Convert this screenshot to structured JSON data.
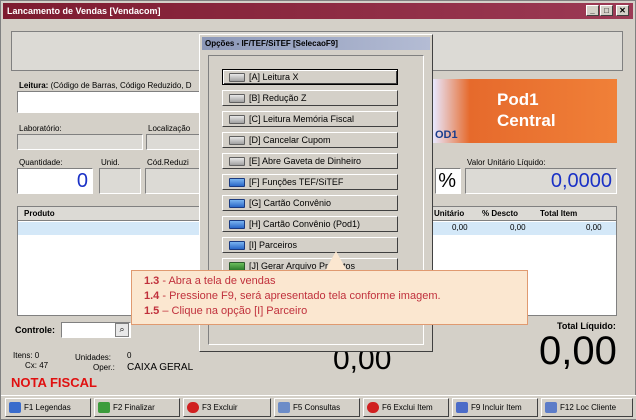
{
  "window": {
    "title": "Lancamento de Vendas [Vendacom]"
  },
  "form": {
    "leitura_label": "Leitura:",
    "leitura_hint": "(Código de Barras, Código Reduzido, D",
    "laboratorio_label": "Laboratório:",
    "localizacao_label": "Localização",
    "quantidade_label": "Quantidade:",
    "quantidade_value": "0",
    "unid_label": "Unid.",
    "cod_reduzido_label": "Cód.Reduzi",
    "percent_value": "%",
    "valor_unitario_label": "Valor Unitário Líquido:",
    "valor_unitario_value": "0,0000"
  },
  "logo": {
    "line1": "Pod1",
    "line2": "Central",
    "small": "OD1"
  },
  "grid": {
    "columns": [
      "Produto",
      "Unitário",
      "% Descto",
      "Total Item"
    ],
    "row": {
      "unitario": "0,00",
      "descto": "0,00",
      "total": "0,00"
    }
  },
  "bottom": {
    "controle_label": "Controle:",
    "itens_label": "Itens: 0",
    "cx_label": "Cx: 47",
    "unidades_label": "Unidades:",
    "unidades_value": "0",
    "oper_label": "Oper.:",
    "oper_value": "CAIXA GERAL",
    "subtotal_value": "0,00",
    "total_label": "Total Líquido:",
    "total_value": "0,00",
    "nota": "NOTA FISCAL"
  },
  "function_bar": [
    {
      "label": "F1 Legendas",
      "icon": "help-icon",
      "color": "#3a6ccc"
    },
    {
      "label": "F2 Finalizar",
      "icon": "check-icon",
      "color": "#3c9c3c"
    },
    {
      "label": "F3 Excluir",
      "icon": "delete-icon",
      "color": "#d02020"
    },
    {
      "label": "F5 Consultas",
      "icon": "document-icon",
      "color": "#6c8cc8"
    },
    {
      "label": "F6 Exclui Item",
      "icon": "delete-icon",
      "color": "#d02020"
    },
    {
      "label": "F9 Incluir Item",
      "icon": "add-item-icon",
      "color": "#4c6cc8"
    },
    {
      "label": "F12 Loc Cliente",
      "icon": "customer-icon",
      "color": "#5c7cc8"
    }
  ],
  "dialog": {
    "title": "Opções - IF/TEF/SiTEF [SelecaoF9]",
    "options": [
      {
        "label": "[A] Leitura X",
        "icon": "printer-icon"
      },
      {
        "label": "[B] Redução Z",
        "icon": "printer-icon"
      },
      {
        "label": "[C] Leitura Memória Fiscal",
        "icon": "printer-icon"
      },
      {
        "label": "[D] Cancelar Cupom",
        "icon": "printer-icon"
      },
      {
        "label": "[E] Abre Gaveta de Dinheiro",
        "icon": "printer-icon"
      },
      {
        "label": "[F] Funções TEF/SiTEF",
        "icon": "card-icon"
      },
      {
        "label": "[G] Cartão Convênio",
        "icon": "card-icon"
      },
      {
        "label": "[H] Cartão Convênio (Pod1)",
        "icon": "card-icon"
      },
      {
        "label": "[I] Parceiros",
        "icon": "card-icon"
      },
      {
        "label": "[J] Gerar Arquivo Produtos",
        "icon": "money-icon"
      }
    ]
  },
  "tooltip": {
    "lines": [
      {
        "num": "1.3",
        "text": " - Abra a tela de vendas"
      },
      {
        "num": "1.4",
        "text": " - Pressione F9, será apresentado tela conforme imagem."
      },
      {
        "num": "1.5",
        "text": " – Clique na opção [I] Parceiro"
      }
    ]
  }
}
